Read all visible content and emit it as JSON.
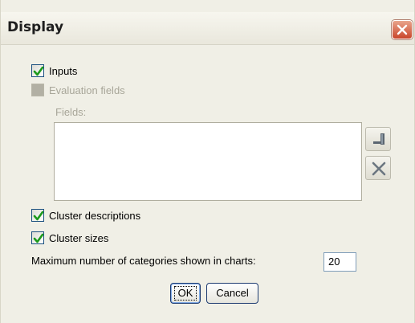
{
  "window": {
    "title": "Display",
    "close_label": "×"
  },
  "options": {
    "inputs": {
      "label": "Inputs",
      "checked": true
    },
    "evaluation_fields": {
      "label": "Evaluation fields",
      "checked": false,
      "enabled": false
    },
    "fields_label": "Fields:",
    "cluster_descriptions": {
      "label": "Cluster descriptions",
      "checked": true
    },
    "cluster_sizes": {
      "label": "Cluster sizes",
      "checked": true
    }
  },
  "max_categories": {
    "label": "Maximum number of categories shown in charts:",
    "value": "20"
  },
  "buttons": {
    "ok": "OK",
    "cancel": "Cancel"
  },
  "icons": {
    "close": "close-icon",
    "field_picker": "field-picker-icon",
    "remove": "remove-x-icon"
  },
  "colors": {
    "dialog_bg": "#f0efe6",
    "close_red": "#c9452a",
    "check_green": "#21a121"
  }
}
